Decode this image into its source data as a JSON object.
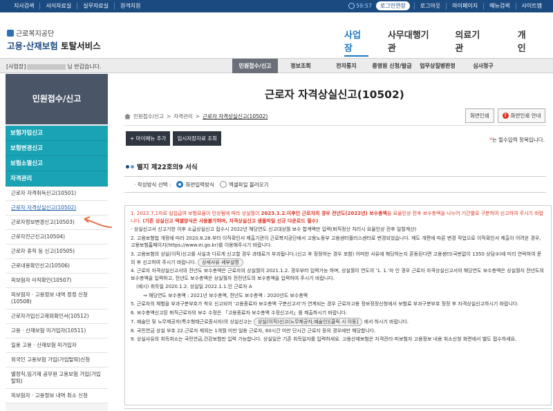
{
  "topbar": {
    "left_links": [
      "지사검색",
      "서식자료실",
      "실무자료실",
      "원격지원"
    ],
    "timer": "59:57",
    "extend_label": "로그인연장",
    "right_links": [
      "로그아웃",
      "마이페이지",
      "메뉴검색",
      "사이트맵"
    ]
  },
  "logo": {
    "org": "근로복지공단",
    "svc_a": "고용·산재보험",
    "svc_b": "토탈서비스"
  },
  "gnb": [
    "사업장",
    "사무대행기관",
    "의료기관",
    "개인"
  ],
  "subbar": {
    "welcome_prefix": "[사업장]",
    "welcome_suffix": "님 반갑습니다.",
    "menus": [
      "민원접수/신고",
      "정보조회",
      "전자통지",
      "증명원 신청/발급",
      "업무상질병판정",
      "심사청구"
    ]
  },
  "sidebar": {
    "title": "민원접수/신고",
    "categories": [
      "보험가입신고",
      "보험변경신고",
      "보험소멸신고",
      "자격관리"
    ],
    "items": [
      "근로자 자격취득신고(10501)",
      "근로자 자격상실신고(10502)",
      "근로자정보변경신고(10503)",
      "근로자전근신고(10504)",
      "근로자 휴직 등 신고(10505)",
      "근로내용확인신고(10506)",
      "피보험자 이직확인(10507)",
      "피보험자 · 고용정보 내역 정정 신청(10508)",
      "근로자가입신고제외확인서(10512)",
      "고용 · 산재보험 미가입자(10511)",
      "일용 고용 · 산재보험 미가입자",
      "외국인 고용보험 가입(가입탈퇴)신청",
      "별정직,임기제 공무원 고용보험 가입(가입탈퇴)",
      "피보험자 · 고용정보 내역 취소 신청"
    ]
  },
  "main": {
    "title": "근로자 자격상실신고(10502)",
    "breadcrumb": [
      "민원접수/신고",
      "자격관리",
      "근로자 자격상실신고(10502)"
    ],
    "print_label": "화면인쇄",
    "print_guide_label": "화면인쇄 안내",
    "add_menu_label": "+ 마이메뉴 추가",
    "temp_save_label": "임시저장자료 조회",
    "required_star": "*",
    "required_note": "는 필수입력 항목입니다.",
    "section_title": "별지 제22호의9 서식",
    "choice_label": "· 작성방식 선택 :",
    "choice_options": [
      "화면입력방식",
      "엑셀파일 불러오기"
    ],
    "notice": {
      "n1_prefix": "1. 2022.7.1자로 실업급여 보험요율이 인상됨에 따라 상실월이 ",
      "n1_bold1": "2023.1.2.이후인 근로자의 경우 전년도(2022년) 보수총액",
      "n1_mid": "을 요율인상 전후 보수총액을 나누어 기간별로 구분하여 신고하여 주시기 바랍니다. ",
      "n1_bold2": "(기존 상실신고 엑셀양식은 사용불가하며, 자격상실신고 샘플파일 신규 다운로드 필수)",
      "n1_sub": "- 상실신고서 신고기한 이후 소급상실신고 접수시 2022년 해당연도 신고대상월 보수 합계액만 입력(퇴직정산 처리시 요율인상 전후 일할계산)",
      "n2": "2. 고용보험법 개정에 따라 2020.8.28.부터 이직확인서 제출기관이 근로복지공단에서 고용노동부 고용센터플러스센터로 변경되었습니다. 제도 개편에 따른 변경 작업으로 이직확인서 제출이 어려운 경우, 고용보험홈페이지(https://www.ei.go.kr)를 이용해주시기 바랍니다.",
      "n3": "3. 고용보험의 상실(이직)신고를 사실과 다르게 신고할 경우 과태료가 부과됩니다.(신고 후 정정하는 경우 포함) 어떠한 사유에 해당하는지 혼동된다면 고용센터(국번없이 1350 상담③)에 미리 연락하여 문의 후 신고하여 주시기 바랍니다.",
      "n3_btn": "상세사유 세부설명",
      "n4": "4. 근로자 자격상실신고서의 전년도 보수총액은 근로자의 상실월이 2021.1.2. 경우부터 입력가능 하며, 상실월이 연도의 '1. 1.'자 인 경우 근로자 자격상실신고서의 해당연도 보수총액은 상실월자 전년도의 보수총액을 입력하고, 전년도 보수총액은 상실월자 전전년도의 보수총액을 입력하여 주시기 바랍니다.",
      "n4_ex1": "(예시) 취득일 2020.1.2. 상실일 2022.1.1.인 근로자 A",
      "n4_ex2": "⇒ 해당연도 보수총액 : 2021년 보수총액, 전년도 보수총액 : 2020년도 보수총액",
      "n5": "5. 근로자의 체험을 부과구분부호가 착오 신고되어 '고용종료자 보수총액 구분신고서'가 연계되는 경우 근로자고용 정보정정신청에서 보험료 부과구분부호 정정 후 자격상실신고하시기 바랍니다.",
      "n6": "6. 보수총액신고된 퇴직근로자의 보수 수정은 「고용종료자 보수총액 수정신고서」를 제출하시기 바랍니다.",
      "n7_prefix": "7. 예술인 및 노무제공자(특수형태근로종사자)의 상실신고는",
      "n7_btn": "상실(이직)신고(노무제공자,예술인)[클릭 시 이동]",
      "n7_suffix": "에서 하시기 바랍니다.",
      "n8": "8. 국민연금 상실 부호 22.근로자 제외는 1개월 미만 일용 근로자, 60시간 미만 단시간 근로자 등의 경우에만 해당합니다.",
      "n9": "9. 상실사유의 취득취소는 국민연금,건강보험만 입력 가능합니다. 상실일은 기존 취득일자를 입력하세요. 고용산재보험은 자격관리-피보험자 고용정보 내용 취소신청 화면에서 별도 접수하세요."
    }
  },
  "colors": {
    "topbar": "#1b4a80",
    "accent": "#1a78c2",
    "sidebar_cat": "#1aa3b4",
    "sidebar_head": "#4a5568",
    "warning": "#dd3322"
  }
}
